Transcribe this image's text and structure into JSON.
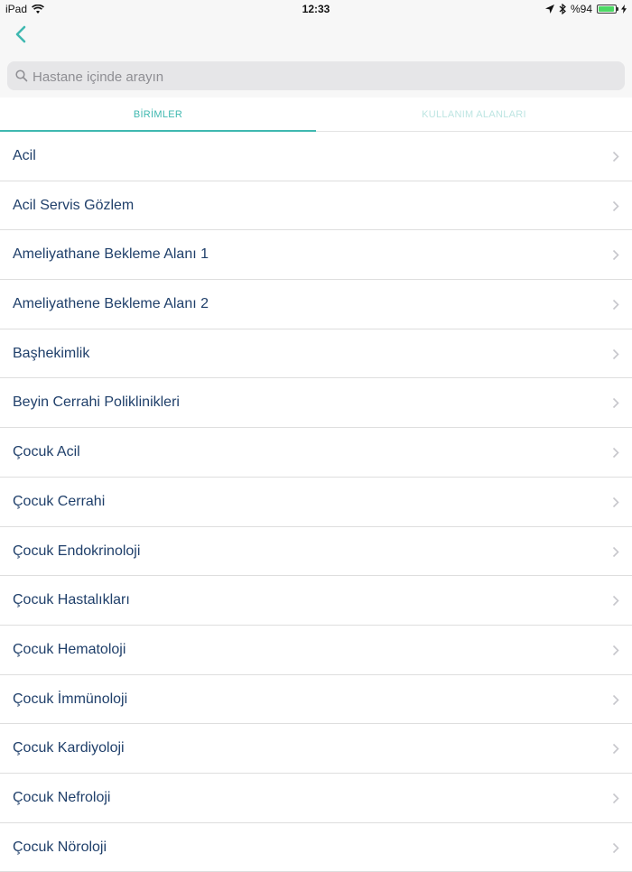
{
  "status_bar": {
    "device": "iPad",
    "time": "12:33",
    "battery": "%94",
    "battery_level": 0.94
  },
  "nav": {
    "back_icon": "chevron-left-icon",
    "accent_color": "#3fb8b0"
  },
  "search": {
    "placeholder": "Hastane içinde arayın",
    "value": ""
  },
  "tabs": [
    {
      "label": "BİRİMLER",
      "active": true
    },
    {
      "label": "KULLANIM ALANLARI",
      "active": false
    }
  ],
  "list": {
    "items": [
      "Acil",
      "Acil Servis Gözlem",
      "Ameliyathane Bekleme Alanı 1",
      "Ameliyathene Bekleme Alanı 2",
      "Başhekimlik",
      "Beyin Cerrahi Poliklinikleri",
      "Çocuk Acil",
      "Çocuk Cerrahi",
      "Çocuk Endokrinoloji",
      "Çocuk Hastalıkları",
      "Çocuk Hematoloji",
      "Çocuk İmmünoloji",
      "Çocuk Kardiyoloji",
      "Çocuk Nefroloji",
      "Çocuk Nöroloji"
    ]
  }
}
